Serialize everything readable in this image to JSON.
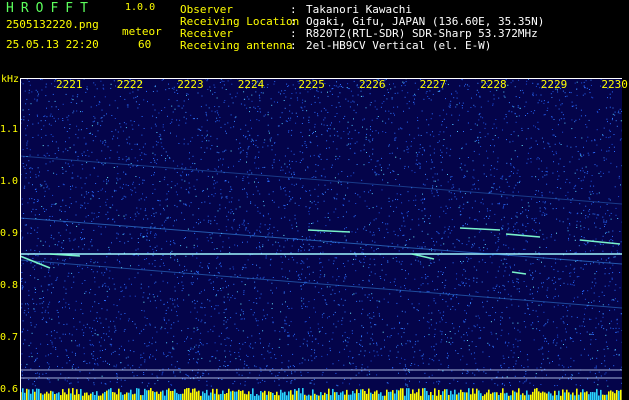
{
  "header": {
    "logo": "HROFFT",
    "version": "1.0.0",
    "file_name": "2505132220.png",
    "meteor_label": "meteor",
    "timestamp": "25.05.13 22:20",
    "meteor_count": "60",
    "meta": [
      {
        "label": "Observer",
        "value": "Takanori Kawachi"
      },
      {
        "label": "Receiving Location",
        "value": "Ogaki, Gifu, JAPAN (136.60E, 35.35N)"
      },
      {
        "label": "Receiver",
        "value": "R820T2(RTL-SDR) SDR-Sharp 53.372MHz"
      },
      {
        "label": "Receiving antenna",
        "value": "2el-HB9CV Vertical (el. E-W)"
      }
    ],
    "separator": ":"
  },
  "spectrogram": {
    "unit": "kHz",
    "y_ticks": [
      "1.1",
      "1.0",
      "0.9",
      "0.8",
      "0.7",
      "0.6"
    ],
    "y_values": [
      1.1,
      1.0,
      0.9,
      0.8,
      0.7,
      0.6
    ],
    "y_range": [
      0.58,
      1.2
    ],
    "x_ticks": [
      "2221",
      "2222",
      "2223",
      "2224",
      "2225",
      "2226",
      "2227",
      "2228",
      "2229",
      "2230"
    ],
    "colors": {
      "background": "#04044a",
      "noise": "#2a6cff",
      "signal": "#9ff7ff",
      "axis_text": "#ffff00"
    }
  }
}
